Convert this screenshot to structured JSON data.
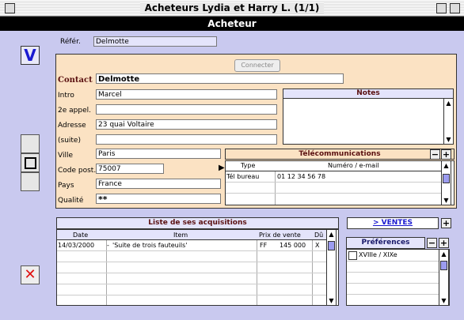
{
  "window": {
    "title": "Acheteurs Lydia et Harry L. (1/1)"
  },
  "header": {
    "title": "Acheteur"
  },
  "ref": {
    "label": "Référ.",
    "value": "Delmotte"
  },
  "connect_button": "Connecter",
  "contact": {
    "contact_label": "Contact",
    "contact_value": "Delmotte",
    "intro_label": "Intro",
    "intro_value": "Marcel",
    "appel_label": "2e appel.",
    "appel_value": "",
    "adresse_label": "Adresse",
    "adresse_value": "23 quai Voltaire",
    "suite_label": "(suite)",
    "suite_value": "",
    "ville_label": "Ville",
    "ville_value": "Paris",
    "cp_label": "Code post.",
    "cp_value": "75007",
    "pays_label": "Pays",
    "pays_value": "France",
    "qualite_label": "Qualité",
    "qualite_value": "**"
  },
  "notes": {
    "title": "Notes",
    "value": ""
  },
  "telecom": {
    "title": "Télécommunications",
    "col_type": "Type",
    "col_num": "Numéro / e-mail",
    "rows": [
      {
        "type": "Tél bureau",
        "num": "01 12 34 56 78"
      }
    ]
  },
  "acquisitions": {
    "title": "Liste de ses acquisitions",
    "headers": {
      "date": "Date",
      "item": "Item",
      "prix": "Prix de vente",
      "du": "Dû"
    },
    "rows": [
      {
        "date": "14/03/2000",
        "item": "'Suite de trois fauteuils'",
        "cur": "FF",
        "prix": "145 000",
        "du": "X"
      }
    ]
  },
  "ventes": {
    "label": "> VENTES"
  },
  "preferences": {
    "title": "Préférences",
    "items": [
      {
        "label": "XVIIIe / XIXe",
        "checked": false
      }
    ]
  },
  "icons": {
    "validate": "check-v-icon",
    "cancel": "x-icon",
    "record": "square-icon"
  },
  "colors": {
    "background": "#c9c9ef",
    "panel": "#fbe2c3",
    "accent_blue": "#1a1ad0",
    "cancel_red": "#e01010"
  }
}
